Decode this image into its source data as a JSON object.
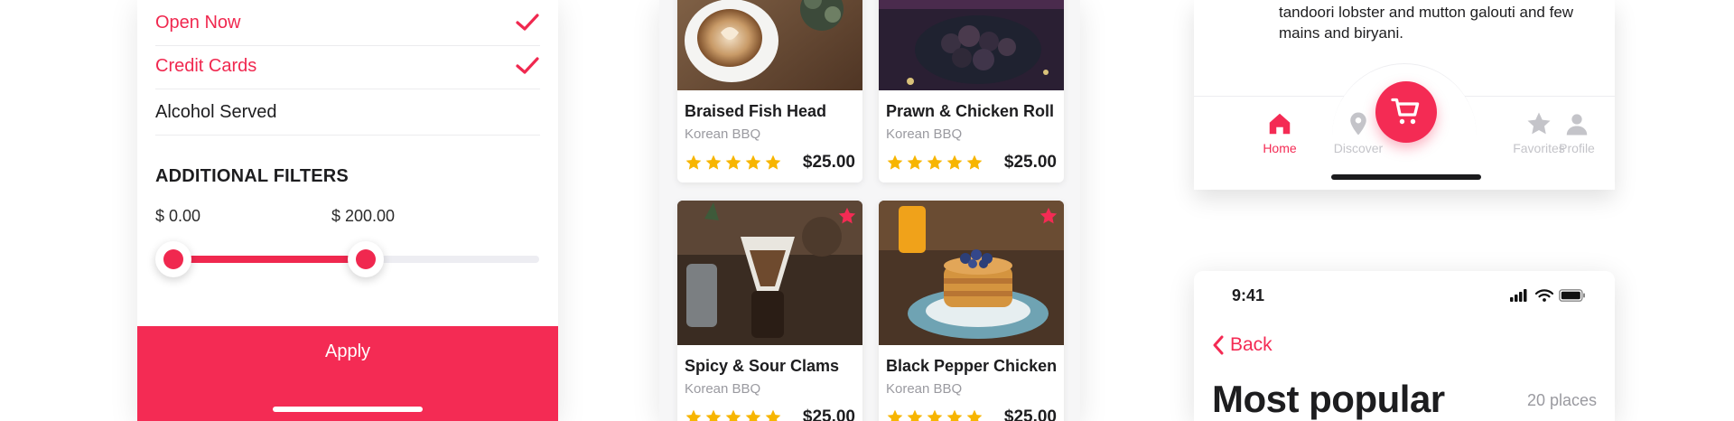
{
  "filters": {
    "options": [
      {
        "label": "Open Now",
        "checked": true
      },
      {
        "label": "Credit Cards",
        "checked": true
      },
      {
        "label": "Alcohol Served",
        "checked": false
      }
    ],
    "section_title": "ADDITIONAL FILTERS",
    "price_min_label": "$ 0.00",
    "price_max_label": "$ 200.00",
    "slider_min_value": 0,
    "slider_max_value": 200,
    "apply_label": "Apply",
    "accent_color": "#f42b54"
  },
  "food_cards": [
    {
      "title": "Braised Fish Head",
      "subtitle": "Korean BBQ",
      "rating": 5,
      "price": "$25.00",
      "photo": "latte-coffee",
      "favorite": false
    },
    {
      "title": "Prawn & Chicken Roll",
      "subtitle": "Korean BBQ",
      "rating": 5,
      "price": "$25.00",
      "photo": "dark-dessert-balls",
      "favorite": false
    },
    {
      "title": "Spicy & Sour Clams",
      "subtitle": "Korean BBQ",
      "rating": 5,
      "price": "$25.00",
      "photo": "pour-over-coffee",
      "favorite": true
    },
    {
      "title": "Black Pepper Chicken",
      "subtitle": "Korean BBQ",
      "rating": 5,
      "price": "$25.00",
      "photo": "blueberry-pancakes",
      "favorite": true
    }
  ],
  "tab_card": {
    "description": "tandoori lobster and mutton galouti and few mains and biryani.",
    "tabs": [
      {
        "label": "Home",
        "icon": "home-icon",
        "active": true
      },
      {
        "label": "Discover",
        "icon": "map-pin-icon",
        "active": false
      },
      {
        "label": "Favorites",
        "icon": "star-icon",
        "active": false
      },
      {
        "label": "Profile",
        "icon": "person-icon",
        "active": false
      }
    ],
    "center_button_icon": "cart-icon"
  },
  "popular": {
    "status_time": "9:41",
    "back_label": "Back",
    "title": "Most popular",
    "count_label": "20 places"
  }
}
